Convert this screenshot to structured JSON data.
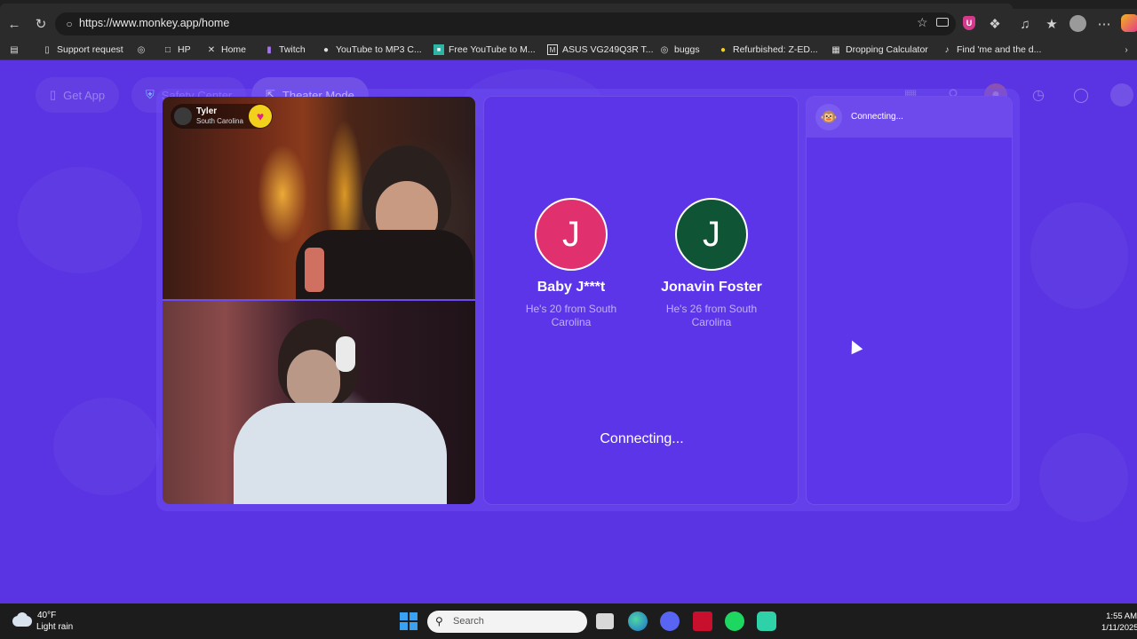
{
  "browser": {
    "url": "https://www.monkey.app/home",
    "bookmarks": [
      {
        "label": "Support request",
        "icon": "ticket-icon"
      },
      {
        "label": "",
        "icon": "globe-icon"
      },
      {
        "label": "HP",
        "icon": "folder-icon"
      },
      {
        "label": "Home",
        "icon": "x-icon"
      },
      {
        "label": "Twitch",
        "icon": "twitch-icon"
      },
      {
        "label": "YouTube to MP3 C...",
        "icon": "site-icon"
      },
      {
        "label": "Free YouTube to M...",
        "icon": "site-icon"
      },
      {
        "label": "ASUS VG249Q3R T...",
        "icon": "site-icon"
      },
      {
        "label": "buggs",
        "icon": "globe-icon"
      },
      {
        "label": "Refurbished: Z-ED...",
        "icon": "site-icon"
      },
      {
        "label": "Dropping Calculator",
        "icon": "calculator-icon"
      },
      {
        "label": "Find 'me and the d...",
        "icon": "tiktok-icon"
      }
    ],
    "extension_badge": "U"
  },
  "nav": {
    "get_app": "Get App",
    "safety_center": "Safety Center",
    "theater_mode": "Theater Mode"
  },
  "video": {
    "remote_user_name": "Tyler",
    "remote_user_location": "South Carolina"
  },
  "matches": [
    {
      "initial": "J",
      "name": "Baby J***t",
      "desc": "He's 20 from South Carolina",
      "color": "#e0306e"
    },
    {
      "initial": "J",
      "name": "Jonavin Foster",
      "desc": "He's 26 from South Carolina",
      "color": "#0f5535"
    }
  ],
  "status": {
    "center_connecting": "Connecting...",
    "chat_connecting": "Connecting..."
  },
  "colors": {
    "page_bg": "#5a34e2",
    "accent_yellow": "#f2d11c"
  },
  "taskbar": {
    "weather_temp": "40°F",
    "weather_desc": "Light rain",
    "search_placeholder": "Search",
    "time": "1:55 AM",
    "date": "1/11/2025"
  }
}
